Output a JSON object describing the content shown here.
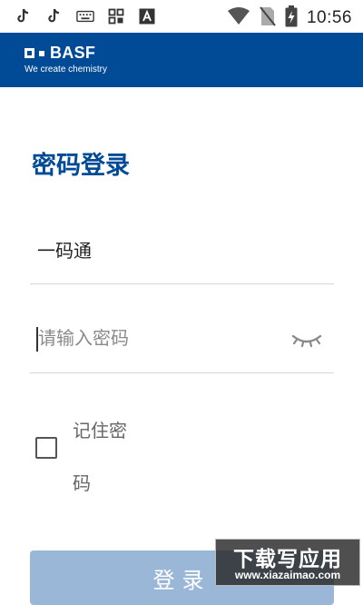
{
  "status_bar": {
    "time": "10:56",
    "left_icons": [
      "tiktok-icon",
      "tiktok-icon",
      "keyboard-icon",
      "apps-icon",
      "a-icon"
    ],
    "right_icons": [
      "wifi-icon",
      "no-sim-icon",
      "battery-charging-icon"
    ]
  },
  "header": {
    "logo_text": "BASF",
    "tagline": "We create chemistry",
    "background": "#004a96"
  },
  "login": {
    "title": "密码登录",
    "username_value": "一码通",
    "password_placeholder": "请输入密码",
    "password_visibility_icon": "eye-closed-icon",
    "remember_label": "记住密码",
    "remember_checked": false,
    "submit_label": "登录",
    "accent_color": "#004a96",
    "button_color": "#9ab7d8"
  },
  "watermark": {
    "title": "下载写应用",
    "url": "www.xiazaimao.com"
  }
}
